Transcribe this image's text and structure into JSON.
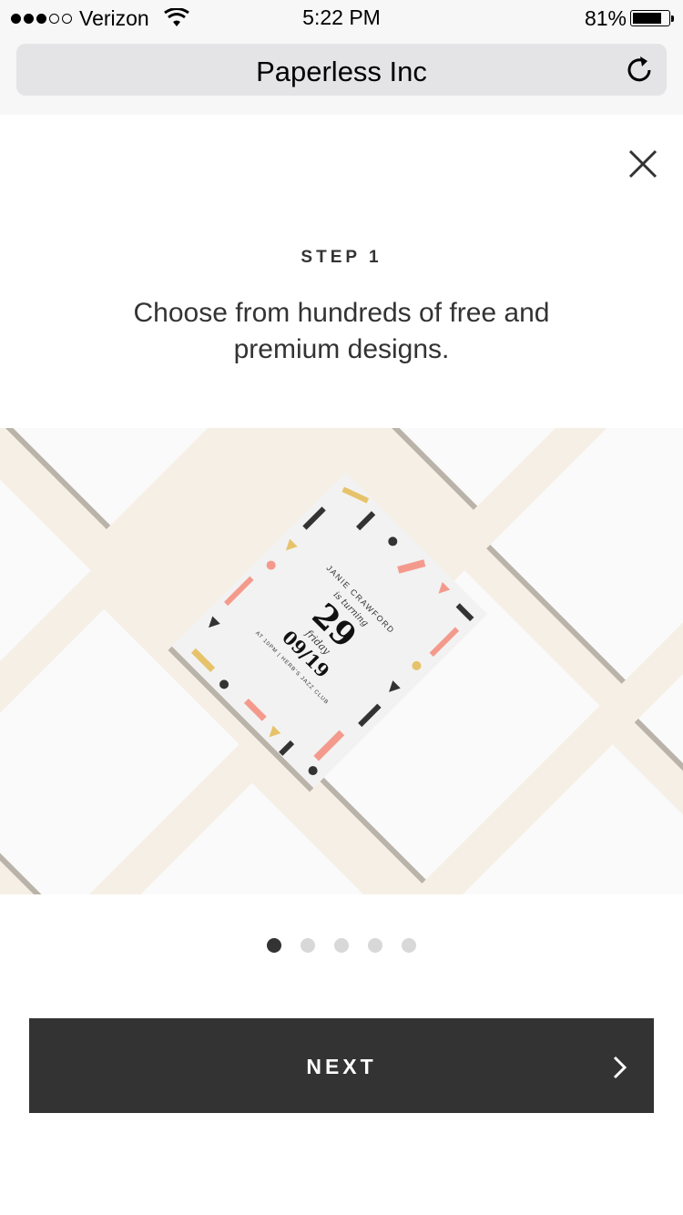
{
  "status_bar": {
    "carrier": "Verizon",
    "time": "5:22 PM",
    "battery_percent": "81%",
    "battery_level": 0.81,
    "signal_bars_filled": 3,
    "signal_bars_total": 5
  },
  "browser": {
    "url_title": "Paperless Inc",
    "reload_icon": "reload-icon"
  },
  "onboarding": {
    "close_icon": "close-icon",
    "step_label": "STEP 1",
    "headline": "Choose from hundreds of free and premium designs.",
    "page_count": 5,
    "active_page": 1,
    "next_label": "NEXT",
    "next_icon": "chevron-right-icon"
  },
  "invitation_card": {
    "name": "JANIE CRAWFORD",
    "subtitle": "is turning",
    "age": "29",
    "day": "friday",
    "date": "09/19",
    "details": "AT 10PM | HERB'S JAZZ CLUB"
  },
  "colors": {
    "button_bg": "#333333",
    "hero_bg": "#f6efe5",
    "dot_active": "#333333",
    "dot_inactive": "#d8d8d8",
    "accent_pink": "#f49a8c",
    "accent_gold": "#e6c36a"
  }
}
